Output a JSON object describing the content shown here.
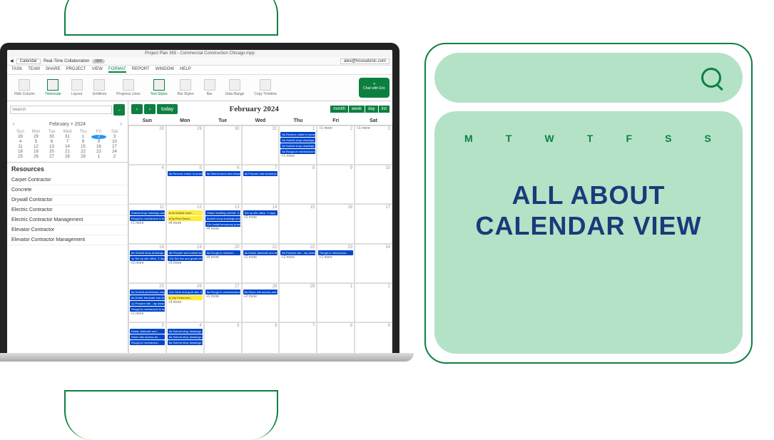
{
  "app": {
    "title": "Project Plan 365 - Commercial Construction Chicago.mpp",
    "user_email": "alex@housatonic.com",
    "view_dropdown": "Calendar",
    "rtc_label": "Real-Time Collaboration",
    "rtc_state": "OFF"
  },
  "menubar": [
    "TASK",
    "TEAM",
    "SHARE",
    "PROJECT",
    "VIEW",
    "FORMAT",
    "REPORT",
    "WINDOW",
    "HELP"
  ],
  "ribbon": [
    {
      "label": "Hide Column"
    },
    {
      "label": "Timescale"
    },
    {
      "label": "Layout"
    },
    {
      "label": "Gridlines"
    },
    {
      "label": "Progress Lines"
    },
    {
      "label": "Text Styles"
    },
    {
      "label": "Bar Styles"
    },
    {
      "label": "Bar"
    },
    {
      "label": "Data Range"
    },
    {
      "label": "Copy Timeline"
    }
  ],
  "chat_label": "Chat with Eric",
  "sidebar": {
    "search_placeholder": "Search",
    "mini_cal": {
      "month": "February",
      "year": "2024",
      "days": [
        "Sun",
        "Mon",
        "Tue",
        "Wed",
        "Thu",
        "Fri",
        "Sat"
      ],
      "today": 2
    },
    "resources_heading": "Resources",
    "resources": [
      "Carpet Contractor",
      "Concrete",
      "Drywall Contractor",
      "Electric Contractor",
      "Electric Contractor Management",
      "Elevator Contractor",
      "Elevator Contractor Management"
    ]
  },
  "calendar": {
    "title": "February 2024",
    "today_btn": "today",
    "views": [
      "month",
      "week",
      "day",
      "list"
    ],
    "day_headers": [
      "Sun",
      "Mon",
      "Tue",
      "Wed",
      "Thu",
      "Fri",
      "Sat"
    ],
    "weeks": [
      [
        {
          "n": "28"
        },
        {
          "n": "29"
        },
        {
          "n": "30"
        },
        {
          "n": "31"
        },
        {
          "n": "1",
          "e": [
            "8a Receive notice to proceed and sign contract, 3 days",
            "8a Submit shop drawings and order long lead items - steel, 2…",
            "8a Submit shop drawings and order long lead items, 4 wks",
            "8a Rough-in mechanical in drywall walls, 2 wks"
          ],
          "m": "+1 more"
        },
        {
          "n": "2",
          "m": "+1 more"
        },
        {
          "n": "3",
          "m": "+1 more"
        }
      ],
      [
        {
          "n": "4"
        },
        {
          "n": "5",
          "e": [
            "8a Receive notice to proceed and sign co…"
          ]
        },
        {
          "n": "6",
          "e": [
            "8a Submit bond and insurance documen…"
          ]
        },
        {
          "n": "7",
          "e": [
            "8a Prepare and submit project schedule"
          ]
        },
        {
          "n": "8"
        },
        {
          "n": "9"
        },
        {
          "n": "10"
        }
      ],
      [
        {
          "n": "11",
          "e": [
            "Submit shop drawings and order long lead…",
            "Rough-in mechanical in drywall walls, 2…"
          ],
          "m": "+1 more"
        },
        {
          "n": "12",
          "e": [
            "● 8a Submit mont…",
            "● 5p First Gener…"
          ],
          "m": "+6 more"
        },
        {
          "n": "13",
          "e": [
            "Obtain building permits, 3 days",
            "Submit shop drawings and order long lead items - steel, 2 wks",
            "12a Install temporary power, 2.5 days"
          ],
          "m": "+4 more"
        },
        {
          "n": "14",
          "e": [
            "Set up site office, 3 days"
          ],
          "m": "+3 more"
        },
        {
          "n": "15"
        },
        {
          "n": "16"
        },
        {
          "n": "17"
        }
      ],
      [
        {
          "n": "18",
          "e": [
            "8a Submit shop drawings and order long lead items - steel…",
            "1p Set up site office, 3 days"
          ],
          "m": "+3 more"
        },
        {
          "n": "19",
          "e": [
            "8a Prepare and submit schedule of valu…",
            "12a Set line and grade benchmarks, 3 days"
          ],
          "m": "+3 more"
        },
        {
          "n": "20",
          "e": [
            "8a Rough-in mechan…"
          ],
          "m": "+4 more"
        },
        {
          "n": "21",
          "e": [
            "8a Detail, fabricate and deliver steel, 4 wk"
          ],
          "m": "+2 more"
        },
        {
          "n": "22",
          "e": [
            "8a Prepare site - lay down yard and tem…"
          ],
          "m": "+2 more"
        },
        {
          "n": "23",
          "e": [
            "Rough-in mechanica…"
          ],
          "m": "+1 more"
        },
        {
          "n": "24"
        }
      ],
      [
        {
          "n": "25",
          "e": [
            "8a Submit preliminary shop drawings, 2 wks",
            "8a Detail, fabricate and deliver steel, 12 wks",
            "1p Prepare site - lay down yard and temporary bracing, 2 day",
            "Rough-in mechanical in masonry walls, 4…"
          ],
          "m": "+1 more"
        },
        {
          "n": "26",
          "e": [
            "12a Clear and grub site, 3 days",
            "● 12p Finish tem…"
          ],
          "m": "+3 more"
        },
        {
          "n": "27",
          "e": [
            "8a Rough-in mechanical in masonry walls, 4…"
          ],
          "m": "+1 more"
        },
        {
          "n": "28",
          "e": [
            "8a Stone site access and temporary park…"
          ],
          "m": "+2 more"
        },
        {
          "n": "29"
        },
        {
          "n": "1"
        },
        {
          "n": "2"
        }
      ],
      [
        {
          "n": "3",
          "e": [
            "Detail, fabricate and…",
            "Stone site access an…",
            "Rough-in mechanica…"
          ]
        },
        {
          "n": "4",
          "e": [
            "8a Submit shop drawings and order long lead items - roofing, 2 wks",
            "8a Submit shop drawings and order long lead items - elevator, 2 wks",
            "8a Submit shop drawings and order long lead items - plumbing, 2…"
          ]
        },
        {
          "n": "5"
        },
        {
          "n": "6"
        },
        {
          "n": "7"
        },
        {
          "n": "8"
        },
        {
          "n": "9"
        }
      ]
    ]
  },
  "promo": {
    "days": [
      "M",
      "T",
      "W",
      "T",
      "F",
      "S",
      "S"
    ],
    "line1": "ALL ABOUT",
    "line2": "CALENDAR VIEW"
  }
}
